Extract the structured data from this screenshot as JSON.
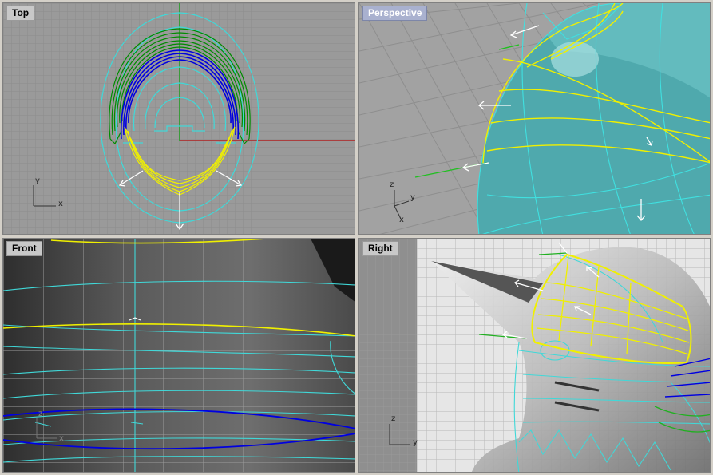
{
  "viewports": {
    "top": {
      "title": "Top",
      "axis_y": "y",
      "axis_x": "x"
    },
    "perspective": {
      "title": "Perspective",
      "axis_z": "z",
      "axis_y": "y",
      "axis_x": "x"
    },
    "front": {
      "title": "Front",
      "axis_z": "z",
      "axis_x": "x"
    },
    "right": {
      "title": "Right",
      "axis_z": "z",
      "axis_y": "y"
    }
  },
  "colors": {
    "viewport_grey": "#9a9a9a",
    "grid_line": "#8a8a8a",
    "grid_major": "#7a7a7a",
    "curve_cyan": "#40d8d8",
    "curve_yellow": "#f0f000",
    "curve_green": "#00a000",
    "curve_blue": "#0000e0",
    "axis_red": "#b02020",
    "axis_green": "#20b020",
    "surface_teal": "#4fa9ad",
    "active_title": "#a9b1cf"
  }
}
